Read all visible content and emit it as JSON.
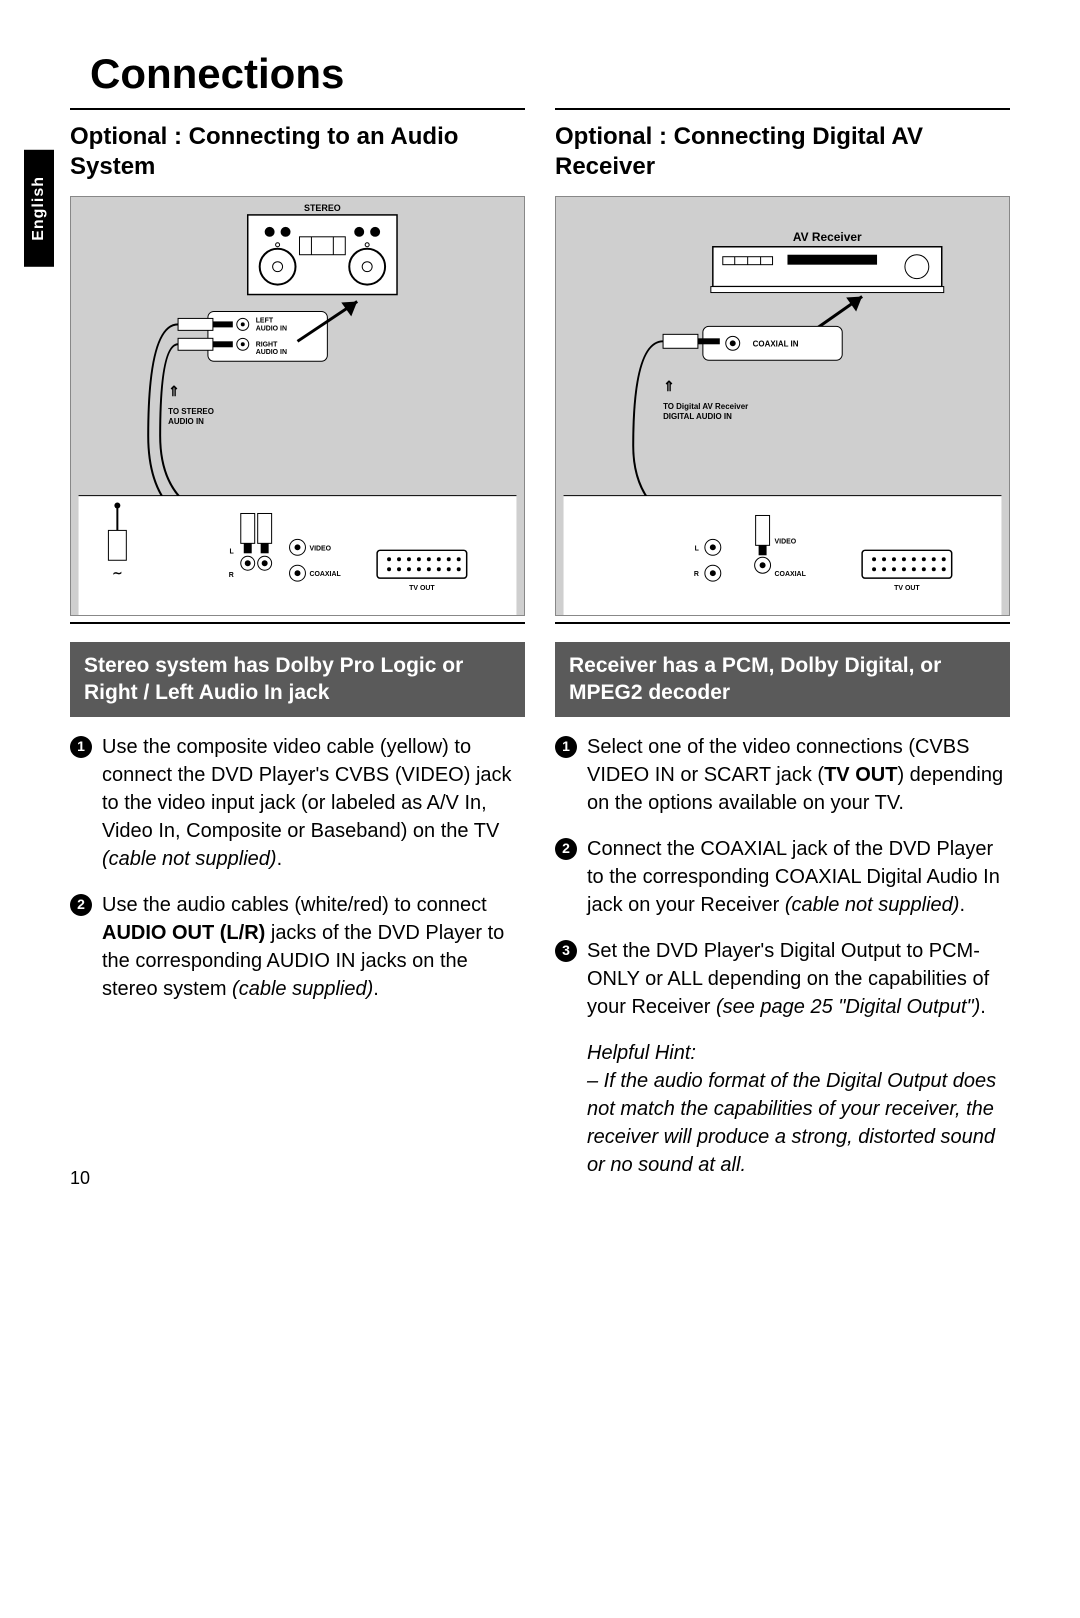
{
  "page": {
    "language_tab": "English",
    "title": "Connections",
    "number": "10"
  },
  "left": {
    "heading": "Optional : Connecting to an Audio System",
    "diagram": {
      "top_label": "STEREO",
      "left_audio": "LEFT AUDIO IN",
      "right_audio": "RIGHT AUDIO IN",
      "arrow_text_1": "TO STEREO",
      "arrow_text_2": "AUDIO IN",
      "jack_video": "VIDEO",
      "jack_l": "L",
      "jack_r": "R",
      "jack_coaxial": "COAXIAL",
      "tvout": "TV OUT"
    },
    "subhead": "Stereo system has Dolby Pro Logic or Right / Left Audio In jack",
    "steps": [
      {
        "n": "1",
        "html": "Use the composite video cable (yellow) to connect the DVD Player's CVBS (VIDEO) jack to the video input jack (or labeled as A/V In, Video In, Composite or Baseband) on the TV <em>(cable not supplied)</em>."
      },
      {
        "n": "2",
        "html": "Use the audio cables (white/red) to connect <b>AUDIO OUT (L/R)</b> jacks of the DVD Player to the corresponding AUDIO IN jacks on the stereo system <em>(cable supplied)</em>."
      }
    ]
  },
  "right": {
    "heading": "Optional : Connecting Digital AV Receiver",
    "diagram": {
      "top_label": "AV Receiver",
      "coaxial_in": "COAXIAL IN",
      "arrow_text_1": "TO Digital AV Receiver",
      "arrow_text_2": "DIGITAL AUDIO IN",
      "jack_video": "VIDEO",
      "jack_l": "L",
      "jack_r": "R",
      "jack_coaxial": "COAXIAL",
      "tvout": "TV OUT"
    },
    "subhead": "Receiver has a PCM, Dolby Digital, or MPEG2 decoder",
    "steps": [
      {
        "n": "1",
        "html": "Select one of the video connections (CVBS VIDEO IN or SCART jack (<b>TV OUT</b>) depending on the options available on your TV."
      },
      {
        "n": "2",
        "html": "Connect the COAXIAL jack of the DVD Player to the corresponding COAXIAL Digital Audio In jack on your Receiver <em>(cable not supplied)</em>."
      },
      {
        "n": "3",
        "html": "Set the DVD Player's Digital Output to PCM-ONLY or ALL depending on the capabilities of your Receiver <em>(see page 25 \"Digital Output\")</em>."
      }
    ],
    "hint_title": "Helpful Hint:",
    "hint_body": "–   If the audio format of the Digital Output does not match the capabilities of your receiver, the receiver will produce a strong, distorted sound or no sound at all."
  }
}
